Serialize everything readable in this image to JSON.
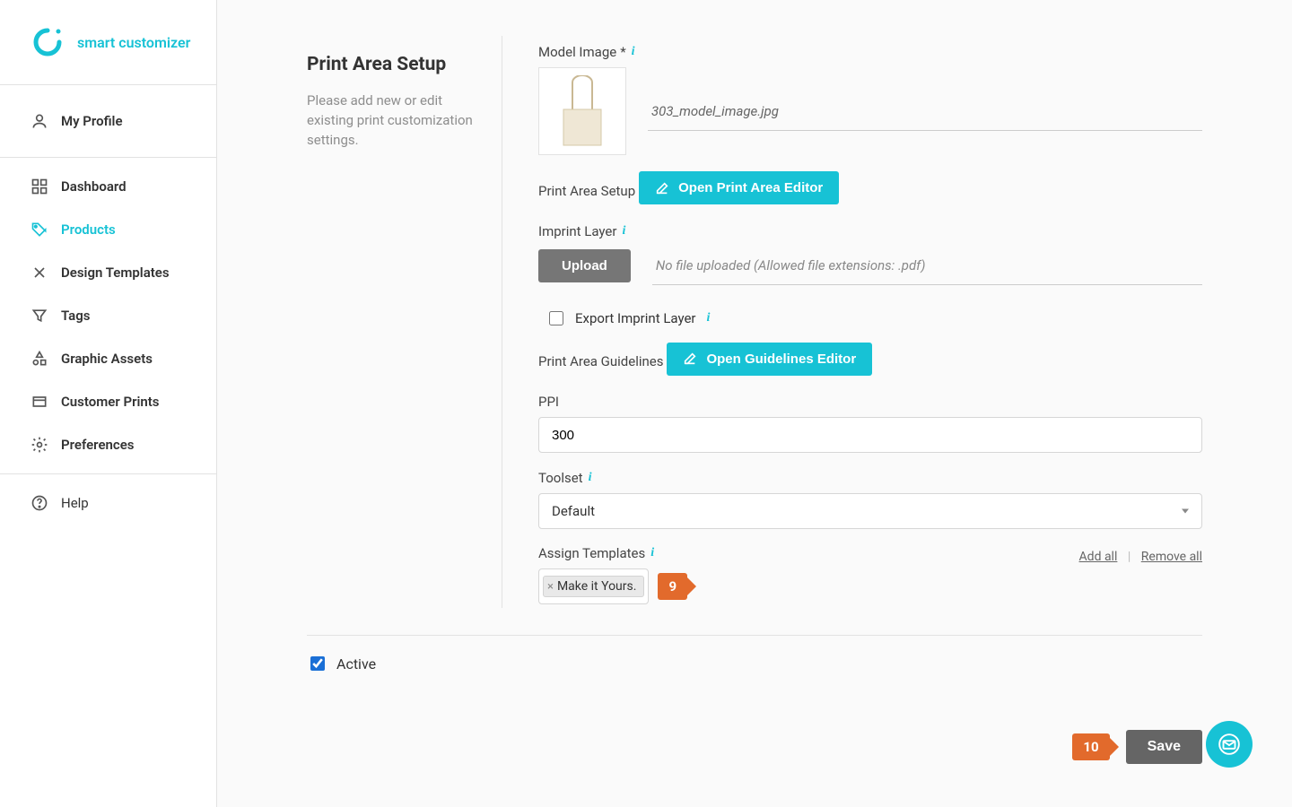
{
  "brand": {
    "name": "smart customizer"
  },
  "sidebar": {
    "profile_label": "My Profile",
    "items": [
      {
        "label": "Dashboard"
      },
      {
        "label": "Products"
      },
      {
        "label": "Design Templates"
      },
      {
        "label": "Tags"
      },
      {
        "label": "Graphic Assets"
      },
      {
        "label": "Customer Prints"
      },
      {
        "label": "Preferences"
      }
    ],
    "help_label": "Help"
  },
  "page": {
    "title": "Print Area Setup",
    "subtitle": "Please add new or edit existing print customization settings."
  },
  "fields": {
    "model_image_label": "Model Image",
    "model_image_filename": "303_model_image.jpg",
    "print_area_setup_label": "Print Area Setup",
    "open_print_area_editor_btn": "Open Print Area Editor",
    "imprint_layer_label": "Imprint Layer",
    "upload_btn": "Upload",
    "upload_hint": "No file uploaded (Allowed file extensions: .pdf)",
    "export_imprint_layer_label": "Export Imprint Layer",
    "export_imprint_layer_checked": false,
    "print_area_guidelines_label": "Print Area Guidelines",
    "open_guidelines_editor_btn": "Open Guidelines Editor",
    "ppi_label": "PPI",
    "ppi_value": "300",
    "toolset_label": "Toolset",
    "toolset_value": "Default",
    "assign_templates_label": "Assign Templates",
    "add_all_label": "Add all",
    "remove_all_label": "Remove all",
    "assigned_templates": [
      {
        "name": "Make it Yours."
      }
    ],
    "step_badge_9": "9",
    "step_badge_10": "10",
    "active_label": "Active",
    "active_checked": true,
    "save_btn": "Save"
  }
}
